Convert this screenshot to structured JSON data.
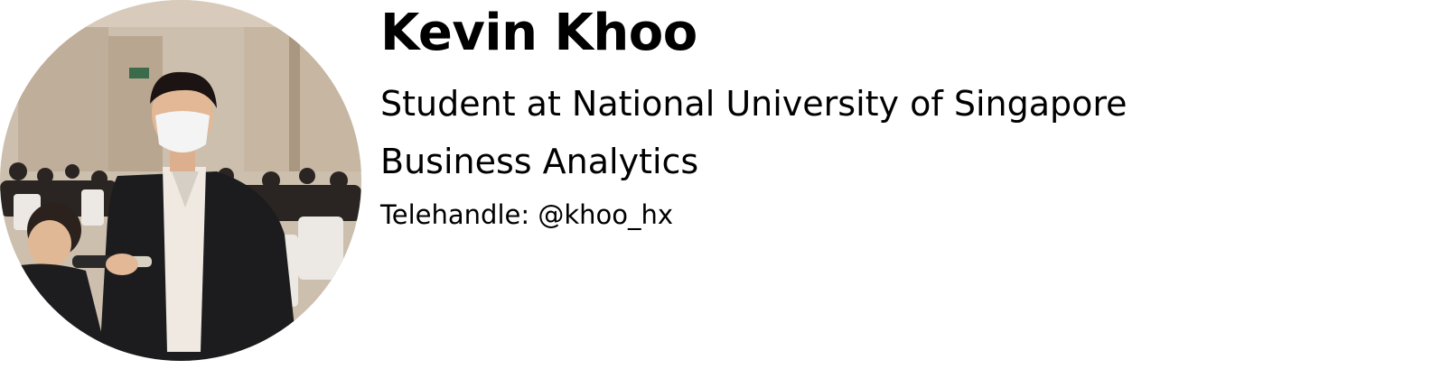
{
  "profile": {
    "name": "Kevin Khoo",
    "headline": "Student at National University of Singapore",
    "major": "Business Analytics",
    "telehandle": "Telehandle: @khoo_hx",
    "photo": "portrait-photo"
  },
  "colors": {
    "text": "#000000",
    "background": "#ffffff",
    "wall": "#cbbba8",
    "suit": "#1c1c1e"
  }
}
